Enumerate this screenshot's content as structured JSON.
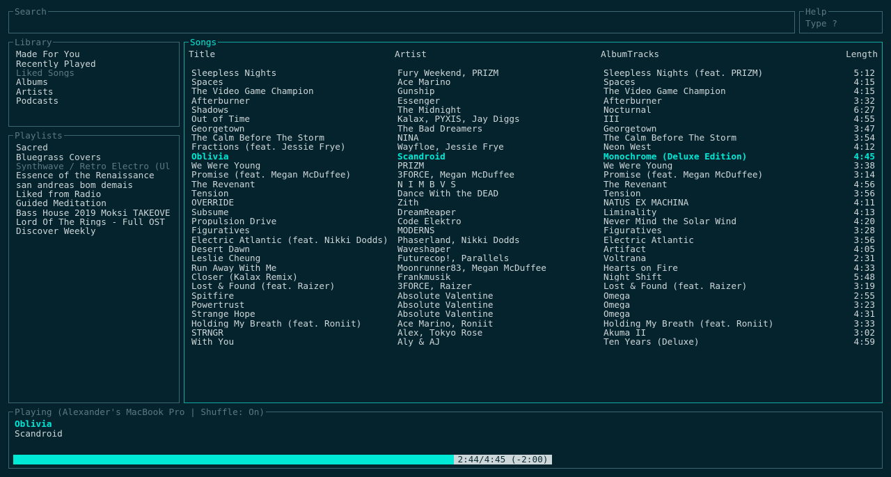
{
  "search": {
    "legend": "Search",
    "value": "",
    "placeholder": ""
  },
  "help": {
    "legend": "Help",
    "hint": "Type ?"
  },
  "library": {
    "legend": "Library",
    "items": [
      {
        "label": "Made For You",
        "selected": false
      },
      {
        "label": "Recently Played",
        "selected": false
      },
      {
        "label": "Liked Songs",
        "selected": true
      },
      {
        "label": "Albums",
        "selected": false
      },
      {
        "label": "Artists",
        "selected": false
      },
      {
        "label": "Podcasts",
        "selected": false
      }
    ]
  },
  "playlists": {
    "legend": "Playlists",
    "items": [
      {
        "label": "Sacred",
        "selected": false
      },
      {
        "label": "Bluegrass Covers",
        "selected": false
      },
      {
        "label": "Synthwave / Retro Electro (Ul",
        "selected": true
      },
      {
        "label": "Essence of the Renaissance",
        "selected": false
      },
      {
        "label": "san andreas bom demais",
        "selected": false
      },
      {
        "label": "Liked from Radio",
        "selected": false
      },
      {
        "label": "Guided Meditation",
        "selected": false
      },
      {
        "label": "Bass House 2019 Moksi TAKEOVE",
        "selected": false
      },
      {
        "label": "Lord Of The Rings - Full OST",
        "selected": false
      },
      {
        "label": "Discover Weekly",
        "selected": false
      }
    ]
  },
  "songs": {
    "legend": "Songs",
    "columns": {
      "title": "Title",
      "artist": "Artist",
      "album": "AlbumTracks",
      "length": "Length"
    },
    "rows": [
      {
        "title": "Sleepless Nights",
        "artist": "Fury Weekend, PRIZM",
        "album": "Sleepless Nights (feat. PRIZM)",
        "length": "5:12",
        "current": false
      },
      {
        "title": "Spaces",
        "artist": "Ace Marino",
        "album": "Spaces",
        "length": "4:15",
        "current": false
      },
      {
        "title": "The Video Game Champion",
        "artist": "Gunship",
        "album": "The Video Game Champion",
        "length": "4:15",
        "current": false
      },
      {
        "title": "Afterburner",
        "artist": "Essenger",
        "album": "Afterburner",
        "length": "3:32",
        "current": false
      },
      {
        "title": "Shadows",
        "artist": "The Midnight",
        "album": "Nocturnal",
        "length": "6:27",
        "current": false
      },
      {
        "title": "Out of Time",
        "artist": "Kalax, PYXIS, Jay Diggs",
        "album": "III",
        "length": "4:55",
        "current": false
      },
      {
        "title": "Georgetown",
        "artist": "The Bad Dreamers",
        "album": "Georgetown",
        "length": "3:47",
        "current": false
      },
      {
        "title": "The Calm Before The Storm",
        "artist": "NINA",
        "album": "The Calm Before The Storm",
        "length": "3:54",
        "current": false
      },
      {
        "title": "Fractions (feat. Jessie Frye)",
        "artist": "Wayfloe, Jessie Frye",
        "album": "Neon West",
        "length": "4:12",
        "current": false
      },
      {
        "title": "Oblivia",
        "artist": "Scandroid",
        "album": "Monochrome (Deluxe Edition)",
        "length": "4:45",
        "current": true
      },
      {
        "title": "We Were Young",
        "artist": "PRIZM",
        "album": "We Were Young",
        "length": "3:38",
        "current": false
      },
      {
        "title": "Promise (feat. Megan McDuffee)",
        "artist": "3FORCE, Megan McDuffee",
        "album": "Promise (feat. Megan McDuffee)",
        "length": "3:14",
        "current": false
      },
      {
        "title": "The Revenant",
        "artist": "N I M B V S",
        "album": "The Revenant",
        "length": "4:56",
        "current": false
      },
      {
        "title": "Tension",
        "artist": "Dance With the DEAD",
        "album": "Tension",
        "length": "3:56",
        "current": false
      },
      {
        "title": "OVERRIDE",
        "artist": "Zith",
        "album": "NATUS EX MACHINA",
        "length": "4:11",
        "current": false
      },
      {
        "title": "Subsume",
        "artist": "DreamReaper",
        "album": "Liminality",
        "length": "4:13",
        "current": false
      },
      {
        "title": "Propulsion Drive",
        "artist": "Code Elektro",
        "album": "Never Mind the Solar Wind",
        "length": "4:20",
        "current": false
      },
      {
        "title": "Figuratives",
        "artist": "MODERNS",
        "album": "Figuratives",
        "length": "3:28",
        "current": false
      },
      {
        "title": "Electric Atlantic (feat. Nikki Dodds)",
        "artist": "Phaserland, Nikki Dodds",
        "album": "Electric Atlantic",
        "length": "3:56",
        "current": false
      },
      {
        "title": "Desert Dawn",
        "artist": "Waveshaper",
        "album": "Artifact",
        "length": "4:05",
        "current": false
      },
      {
        "title": "Leslie Cheung",
        "artist": "Futurecop!, Parallels",
        "album": "Voltrana",
        "length": "2:31",
        "current": false
      },
      {
        "title": "Run Away With Me",
        "artist": "Moonrunner83, Megan McDuffee",
        "album": "Hearts on Fire",
        "length": "4:33",
        "current": false
      },
      {
        "title": "Closer (Kalax Remix)",
        "artist": "Frankmusik",
        "album": "Night Shift",
        "length": "5:48",
        "current": false
      },
      {
        "title": "Lost & Found (feat. Raizer)",
        "artist": "3FORCE, Raizer",
        "album": "Lost & Found (feat. Raizer)",
        "length": "3:19",
        "current": false
      },
      {
        "title": "Spitfire",
        "artist": "Absolute Valentine",
        "album": "Omega",
        "length": "2:55",
        "current": false
      },
      {
        "title": "Powertrust",
        "artist": "Absolute Valentine",
        "album": "Omega",
        "length": "3:23",
        "current": false
      },
      {
        "title": "Strange Hope",
        "artist": "Absolute Valentine",
        "album": "Omega",
        "length": "4:31",
        "current": false
      },
      {
        "title": "Holding My Breath (feat. Roniit)",
        "artist": "Ace Marino, Roniit",
        "album": "Holding My Breath (feat. Roniit)",
        "length": "3:33",
        "current": false
      },
      {
        "title": "STRNGR",
        "artist": "Alex, Tokyo Rose",
        "album": "Akuma II",
        "length": "3:02",
        "current": false
      },
      {
        "title": "With You",
        "artist": "Aly & AJ",
        "album": "Ten Years (Deluxe)",
        "length": "4:59",
        "current": false
      }
    ]
  },
  "playing": {
    "legend": "Playing (Alexander's MacBook Pro | Shuffle: On)",
    "title": "Oblivia",
    "artist": "Scandroid",
    "elapsed": "2:44",
    "total": "4:45",
    "remaining": "-2:00",
    "progress_percent": 57.5
  }
}
